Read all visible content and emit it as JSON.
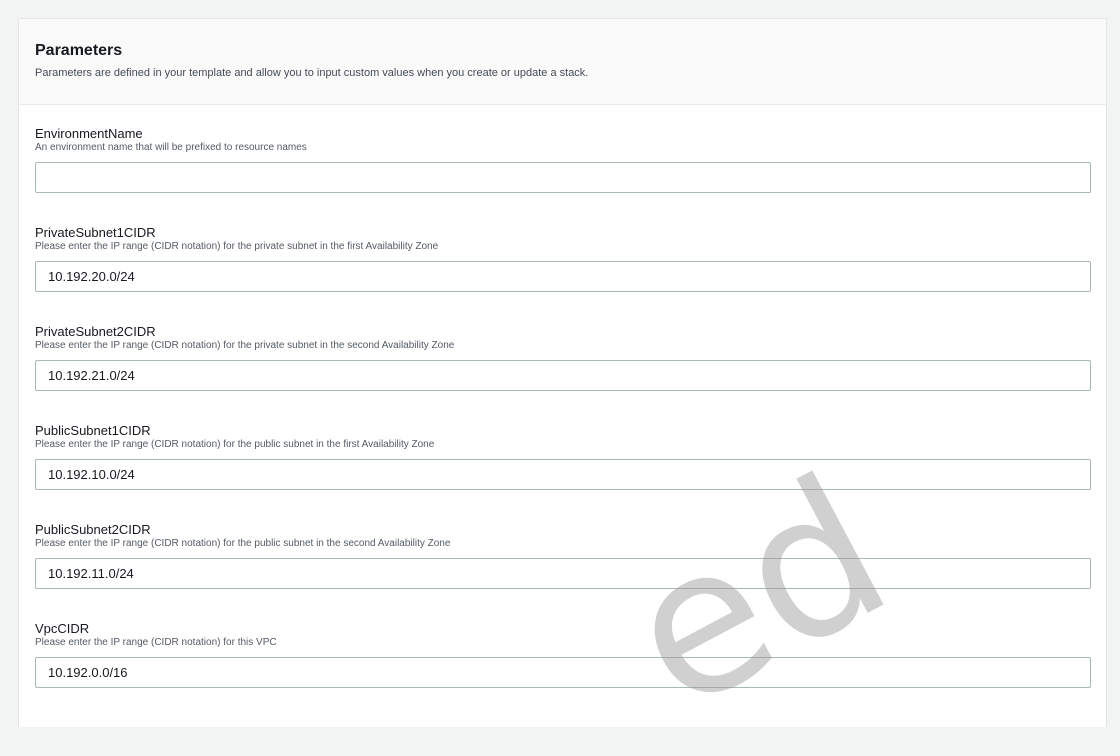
{
  "parameters": {
    "title": "Parameters",
    "description": "Parameters are defined in your template and allow you to input custom values when you create or update a stack.",
    "fields": [
      {
        "label": "EnvironmentName",
        "hint": "An environment name that will be prefixed to resource names",
        "value": ""
      },
      {
        "label": "PrivateSubnet1CIDR",
        "hint": "Please enter the IP range (CIDR notation) for the private subnet in the first Availability Zone",
        "value": "10.192.20.0/24"
      },
      {
        "label": "PrivateSubnet2CIDR",
        "hint": "Please enter the IP range (CIDR notation) for the private subnet in the second Availability Zone",
        "value": "10.192.21.0/24"
      },
      {
        "label": "PublicSubnet1CIDR",
        "hint": "Please enter the IP range (CIDR notation) for the public subnet in the first Availability Zone",
        "value": "10.192.10.0/24"
      },
      {
        "label": "PublicSubnet2CIDR",
        "hint": "Please enter the IP range (CIDR notation) for the public subnet in the second Availability Zone",
        "value": "10.192.11.0/24"
      },
      {
        "label": "VpcCIDR",
        "hint": "Please enter the IP range (CIDR notation) for this VPC",
        "value": "10.192.0.0/16"
      }
    ]
  },
  "watermark": {
    "text": "ed"
  }
}
